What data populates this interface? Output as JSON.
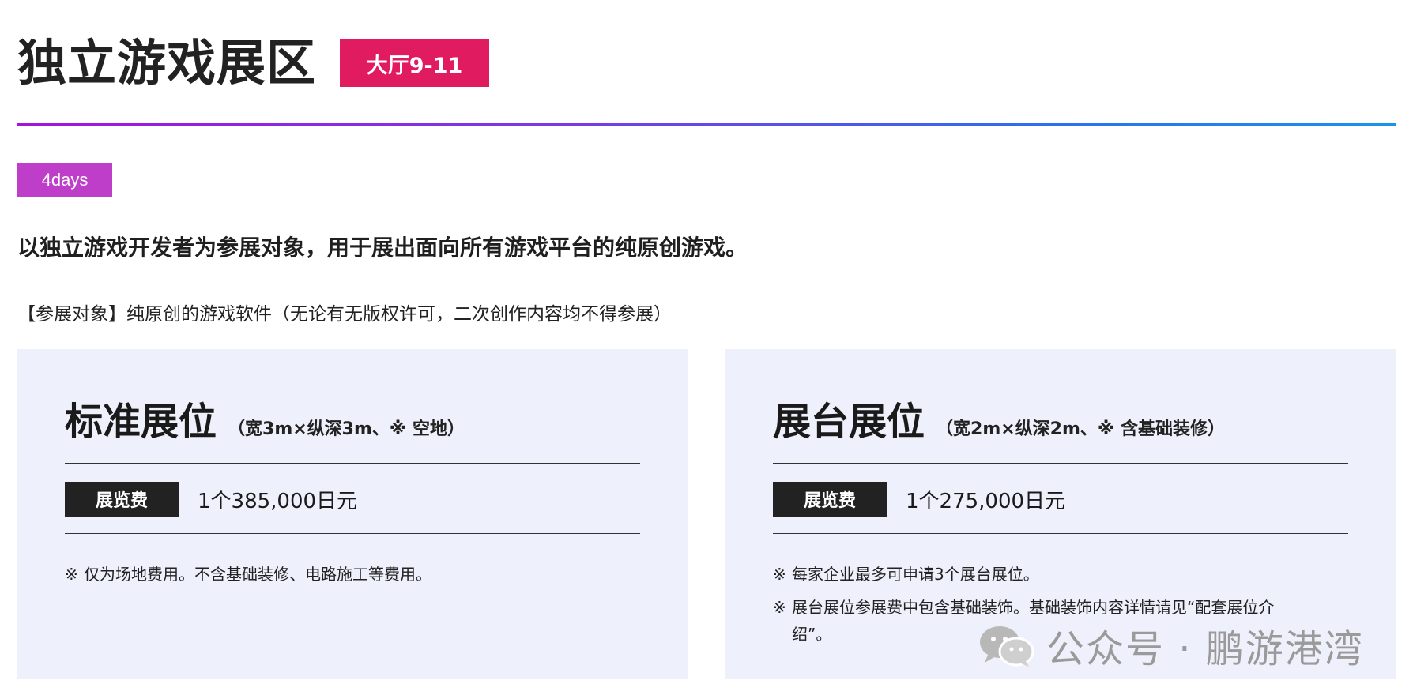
{
  "header": {
    "title": "独立游戏展区",
    "hall_badge": "大厅9-11"
  },
  "days_tag": "4days",
  "intro": "以独立游戏开发者为参展对象，用于展出面向所有游戏平台的纯原创游戏。",
  "target": "【参展对象】纯原创的游戏软件（无论有无版权许可，二次创作内容均不得参展）",
  "cards": [
    {
      "title": "标准展位",
      "subtitle": "（宽3m×纵深3m、※ 空地）",
      "fee_label": "展览费",
      "fee_value": "1个385,000日元",
      "notes": [
        "仅为场地费用。不含基础装修、电路施工等费用。"
      ]
    },
    {
      "title": "展台展位",
      "subtitle": "（宽2m×纵深2m、※ 含基础装修）",
      "fee_label": "展览费",
      "fee_value": "1个275,000日元",
      "notes": [
        "每家企业最多可申请3个展台展位。",
        "展台展位参展费中包含基础装饰。基础装饰内容详情请见“配套展位介绍”。"
      ]
    }
  ],
  "note_mark": "※",
  "watermark": "公众号 · 鹏游港湾",
  "colors": {
    "badge": "#e01b5f",
    "days_tag": "#bf3ec9",
    "card_bg": "#eef1fb",
    "gradient_start": "#a314e0",
    "gradient_end": "#1a93ea"
  }
}
